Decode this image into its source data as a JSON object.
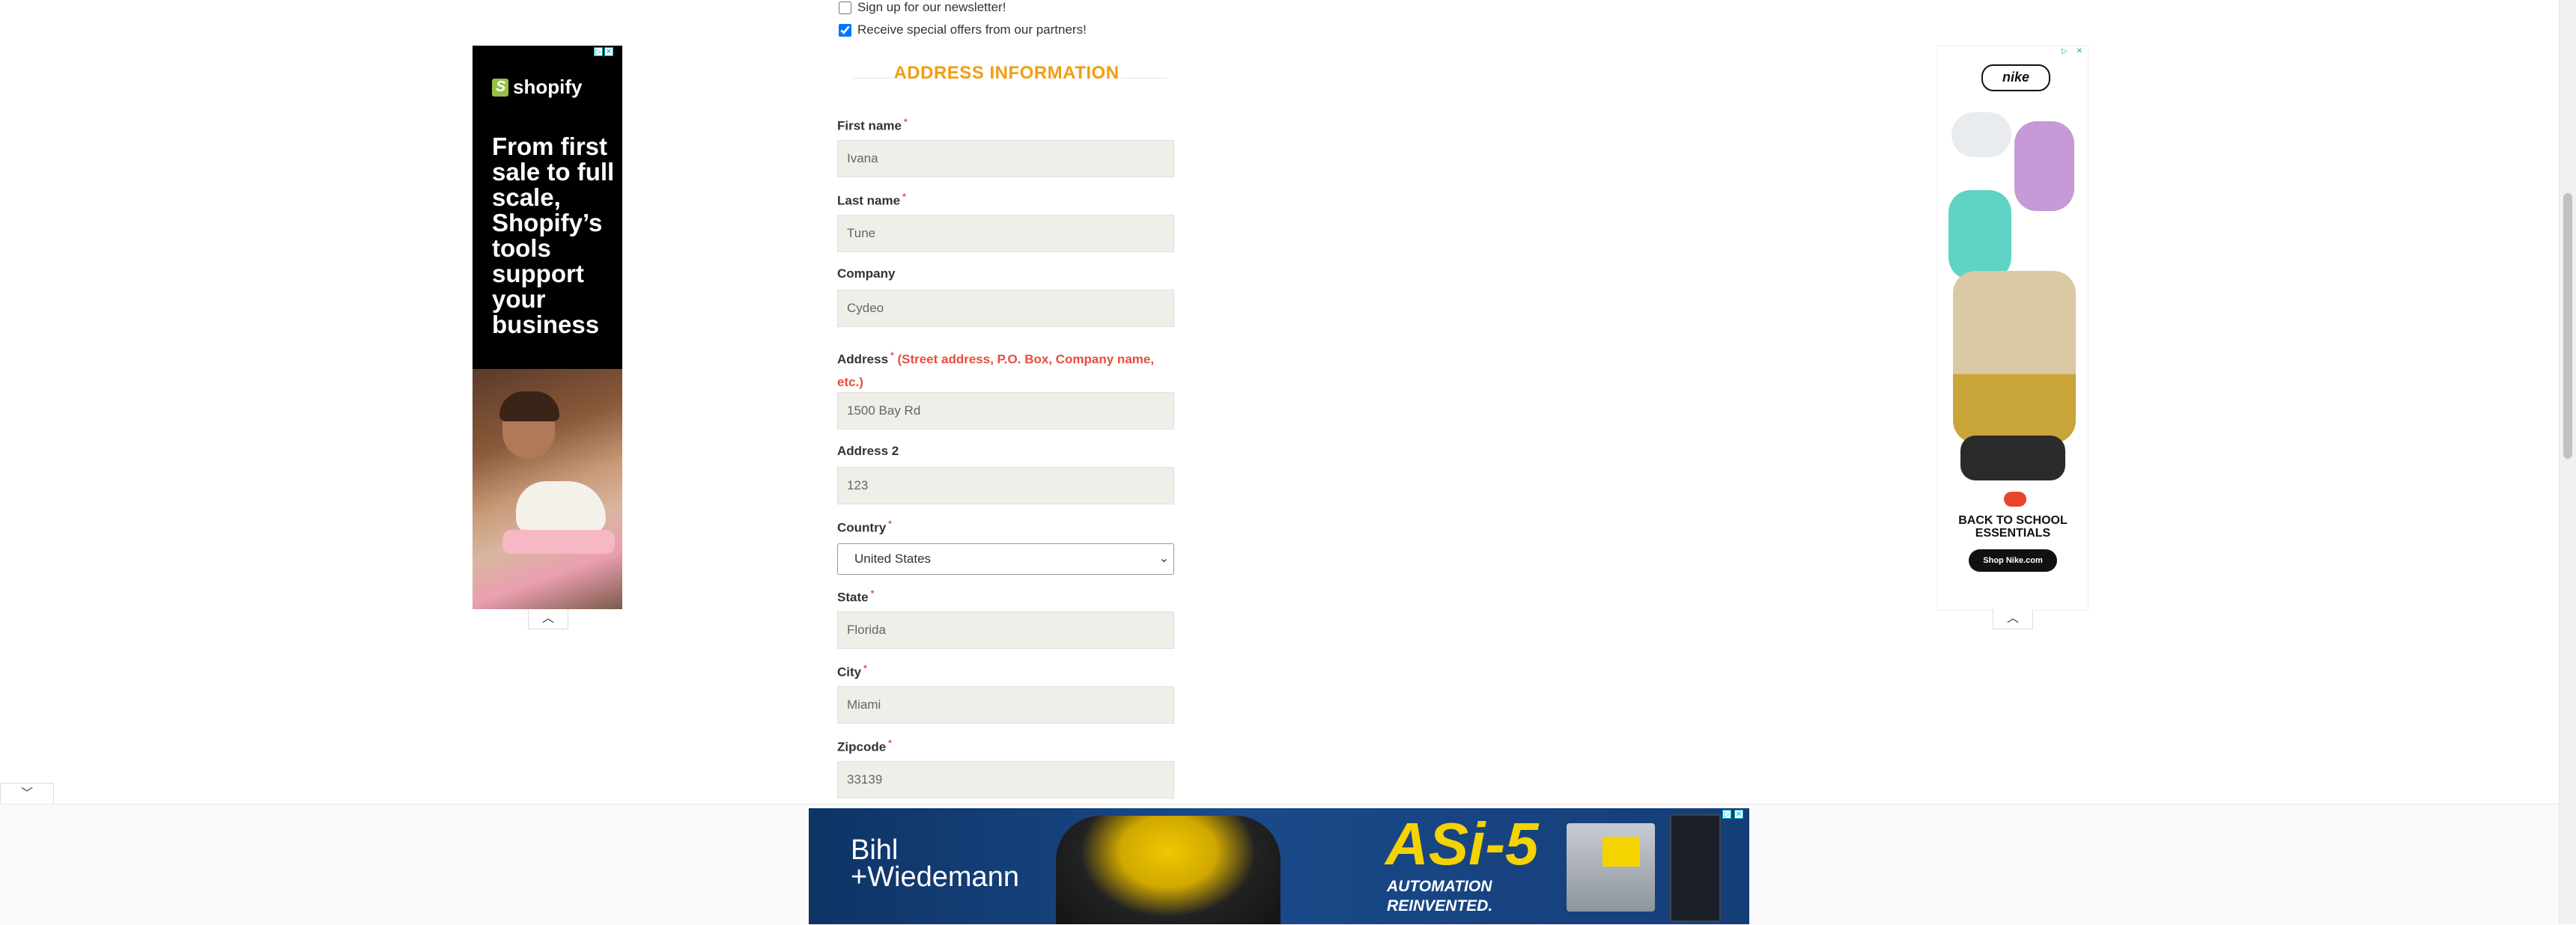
{
  "newsletter": {
    "newsletter_label": "Sign up for our newsletter!",
    "newsletter_checked": false,
    "offers_label": "Receive special offers from our partners!",
    "offers_checked": true
  },
  "section": {
    "title": "ADDRESS INFORMATION"
  },
  "form": {
    "required_mark": "*",
    "first_name": {
      "label": "First name",
      "value": "Ivana"
    },
    "last_name": {
      "label": "Last name",
      "value": "Tune"
    },
    "company": {
      "label": "Company",
      "value": "Cydeo"
    },
    "address": {
      "label": "Address",
      "hint_line1": "(Street address, P.O. Box, Company name,",
      "hint_line2": "etc.)",
      "value": "1500 Bay Rd"
    },
    "address2": {
      "label": "Address 2",
      "value": "123"
    },
    "country": {
      "label": "Country",
      "value": "United States"
    },
    "state": {
      "label": "State",
      "value": "Florida"
    },
    "city": {
      "label": "City",
      "value": "Miami"
    },
    "zipcode": {
      "label": "Zipcode",
      "value": "33139"
    }
  },
  "ads": {
    "left": {
      "brand": "shopify",
      "tagline": "From first sale to full scale, Shopify’s tools support your business",
      "accent": "#95bf47"
    },
    "right": {
      "brand": "nike",
      "headline_line1": "BACK TO SCHOOL",
      "headline_line2": "ESSENTIALS",
      "cta": "Shop Nike.com",
      "accent": "#e8452c"
    },
    "bottom": {
      "brand_line1": "Bihl",
      "brand_line2": "+Wiedemann",
      "product": "ASi-5",
      "tag_line1": "AUTOMATION",
      "tag_line2": "REINVENTED.",
      "accent": "#f4d300"
    }
  },
  "icons": {
    "adchoices": "adchoices-icon",
    "close": "close-icon",
    "chevron_up": "chevron-up-icon",
    "chevron_down": "chevron-down-icon",
    "collapse_up_glyph": "︿",
    "collapse_down_glyph": "﹀",
    "close_glyph": "✕",
    "adchoice_glyph": "▷"
  }
}
